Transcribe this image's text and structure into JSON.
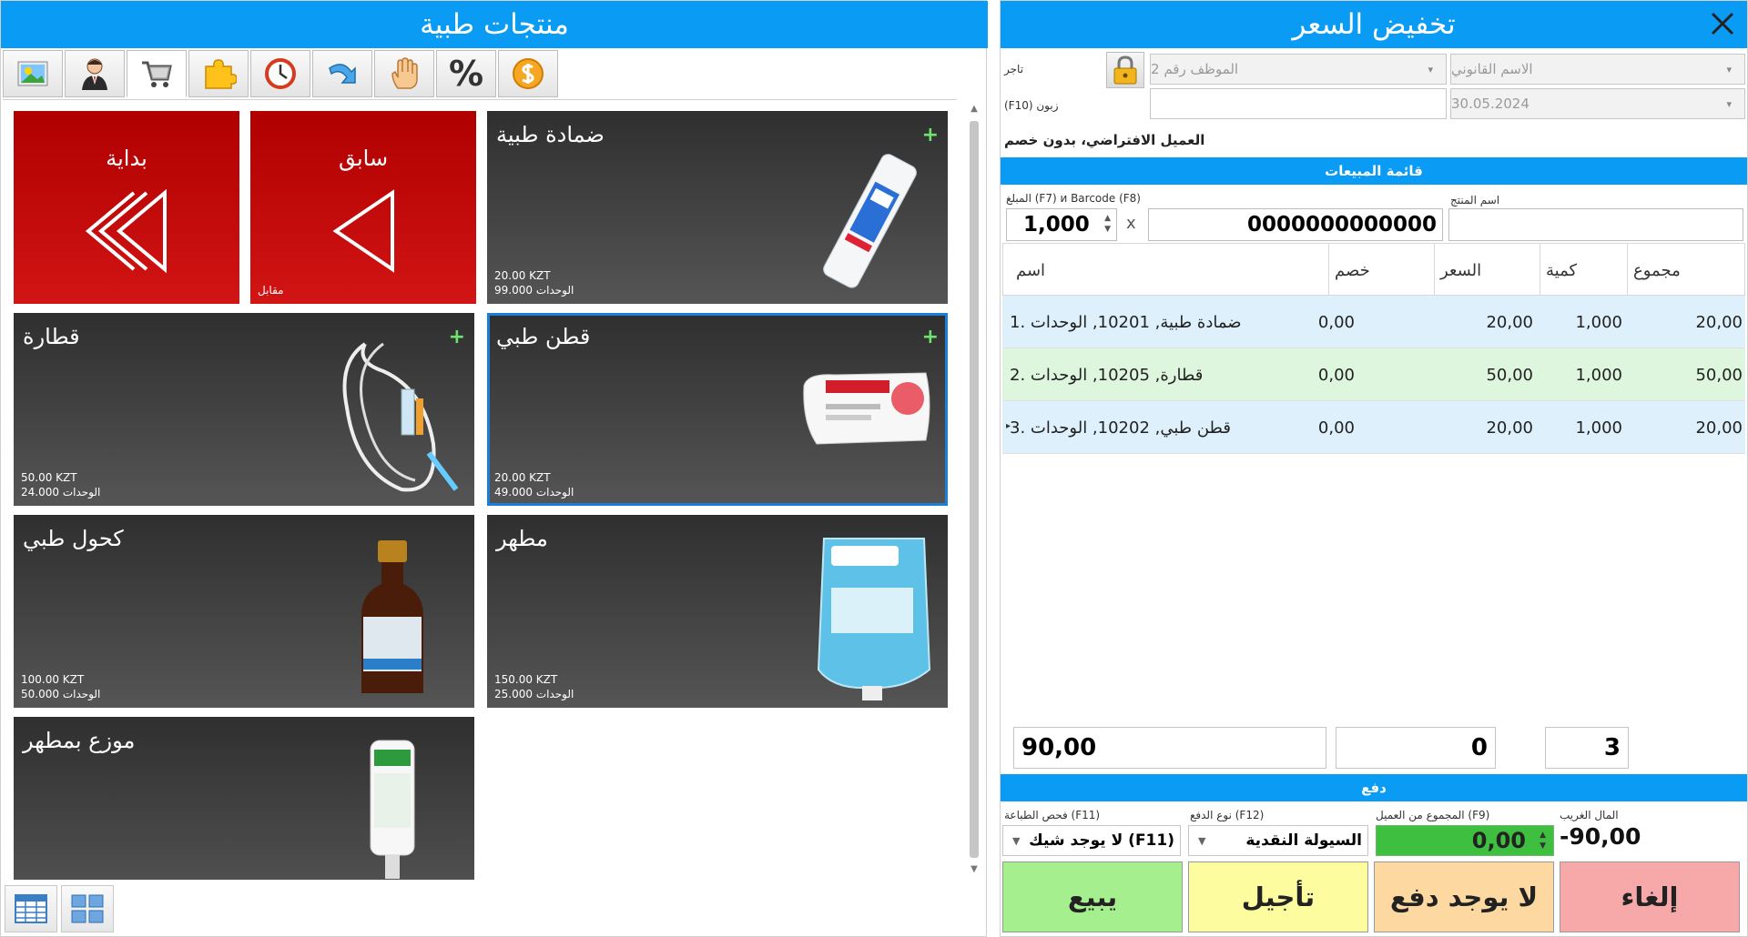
{
  "left_title": "منتجات طبية",
  "toolbar": [
    "photo-icon",
    "person-icon",
    "cart-icon",
    "puzzle-icon",
    "clock-icon",
    "redo-arrow-icon",
    "hand-icon",
    "percent-icon",
    "dollar-icon"
  ],
  "toolbar_percent_label": "%",
  "tiles": {
    "start": {
      "label": "بداية"
    },
    "prev": {
      "label": "سابق",
      "sub": "مقابل"
    },
    "bandage": {
      "name": "ضمادة طبية",
      "price": "20.00 KZT",
      "units": "99.000 الوحدات",
      "plus": "+"
    },
    "dropper": {
      "name": "قطارة",
      "price": "50.00 KZT",
      "units": "24.000 الوحدات",
      "plus": "+"
    },
    "cotton": {
      "name": "قطن طبي",
      "price": "20.00 KZT",
      "units": "49.000 الوحدات",
      "plus": "+"
    },
    "alcohol": {
      "name": "كحول طبي",
      "price": "100.00 KZT",
      "units": "50.000 الوحدات"
    },
    "sanitizer": {
      "name": "مطهر",
      "price": "150.00 KZT",
      "units": "25.000 الوحدات"
    },
    "dispenser": {
      "name": "موزع بمطهر"
    }
  },
  "right_title": "تخفيض السعر",
  "header": {
    "merchant_label": "تاجر",
    "legal_name_placeholder": "الاسم القانوني",
    "employee_placeholder": "الموظف رقم 2",
    "customer_label": "(F10) زبون",
    "date": "30.05.2024",
    "customer_info": "العميل الافتراضي، بدون خصم"
  },
  "sales_list_title": "قائمة المبيعات",
  "entry": {
    "amount_label": "المبلغ (F7) и Barcode (F8)",
    "product_name_label": "اسم المنتج",
    "quantity": "1,000",
    "times": "x",
    "barcode": "0000000000000"
  },
  "table": {
    "headers": {
      "name": "اسم",
      "discount": "خصم",
      "price": "السعر",
      "qty": "كمية",
      "total": "مجموع"
    },
    "rows": [
      {
        "name": "ضمادة طبية, 10201, الوحدات .1",
        "discount": "0,00",
        "price": "20,00",
        "qty": "1,000",
        "total": "20,00"
      },
      {
        "name": "قطارة, 10205, الوحدات .2",
        "discount": "0,00",
        "price": "50,00",
        "qty": "1,000",
        "total": "50,00"
      },
      {
        "name": "قطن طبي, 10202, الوحدات .3",
        "discount": "0,00",
        "price": "20,00",
        "qty": "1,000",
        "total": "20,00"
      }
    ]
  },
  "totals": {
    "sum": "90,00",
    "discount": "0",
    "count": "3"
  },
  "payment_title": "دفع",
  "payment": {
    "receipt_label": "فحص الطباعة (F11)",
    "receipt_value": "(F11) لا يوجد شيك",
    "type_label": "نوع الدفع (F12)",
    "type_value": "السيولة النقدية",
    "received_label": "المجموع من العميل (F9)",
    "received_value": "0,00",
    "change_label": "المال الغريب",
    "change_value": "-90,00"
  },
  "buttons": {
    "sell": "يبيع",
    "defer": "تأجيل",
    "no_pay": "لا يوجد دفع",
    "cancel": "إلغاء"
  },
  "colors": {
    "accent": "#0a9cf5",
    "sell": "#a6ef8e",
    "defer": "#fdfda0",
    "no_pay": "#fdd8a0",
    "cancel": "#f7a8a8",
    "green_field": "#3fbf3f",
    "row_blue": "#def0fb",
    "row_green": "#ddf6dd"
  }
}
